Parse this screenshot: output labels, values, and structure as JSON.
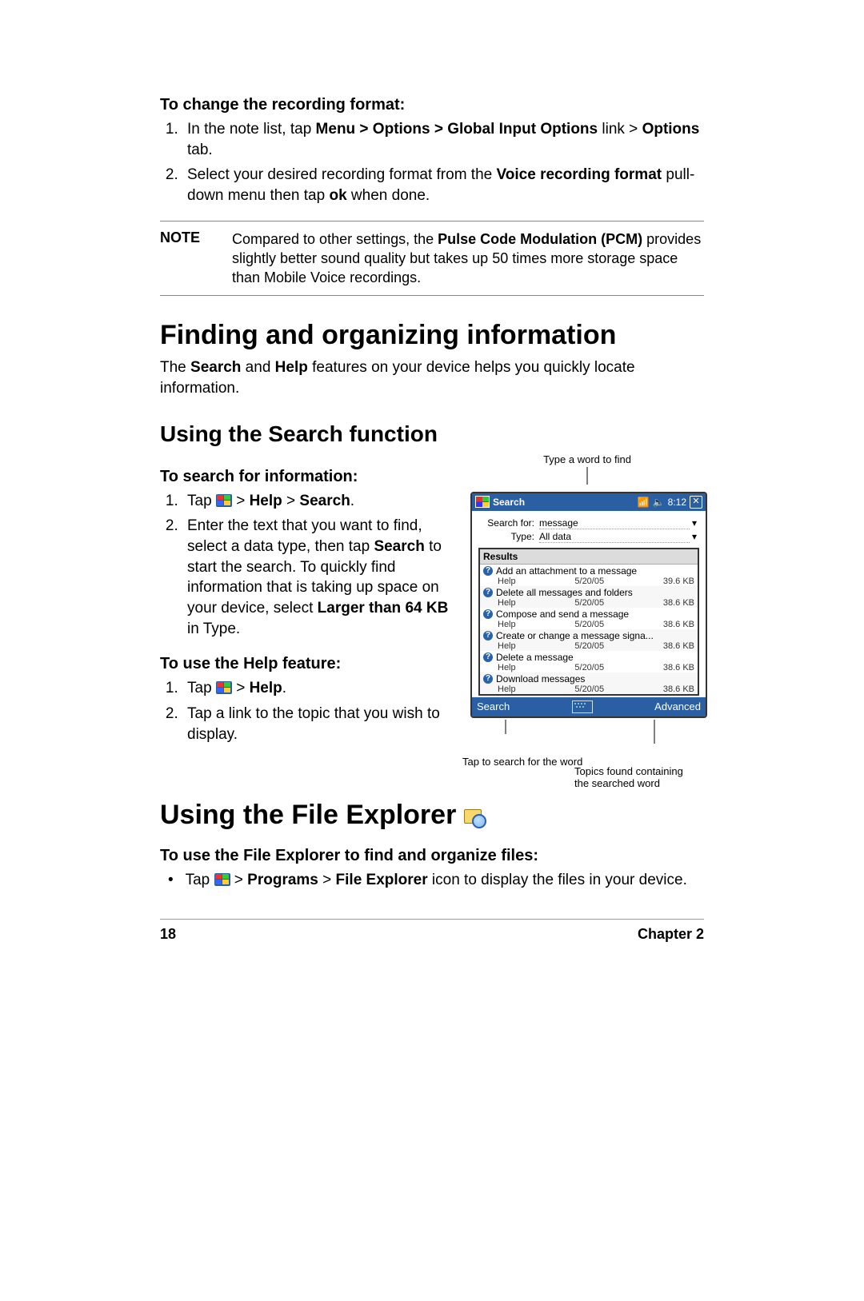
{
  "section_recording_heading": "To change the recording format:",
  "rec_steps": [
    {
      "prefix": "In the note list, tap ",
      "bold": "Menu > Options > Global Input Options",
      "mid": " link > ",
      "bold2": "Options",
      "suffix": " tab."
    },
    {
      "prefix": "Select your desired recording format from the ",
      "bold": "Voice recording format",
      "mid": " pull-down menu then tap ",
      "bold2": "ok",
      "suffix": " when done."
    }
  ],
  "note": {
    "label": "NOTE",
    "prefix": "Compared to other settings, the ",
    "bold": "Pulse Code Modulation (PCM)",
    "suffix": " provides slightly better sound quality but takes up 50 times more storage space than Mobile Voice recordings."
  },
  "h1_1": "Finding and organizing information",
  "intro": {
    "prefix": "The ",
    "b1": "Search",
    "mid": " and ",
    "b2": "Help",
    "suffix": " features on your device helps you quickly locate information."
  },
  "h2_search": "Using the Search function",
  "h3_searchinfo": "To search for information:",
  "search_steps": [
    {
      "prefix": "Tap ",
      "after": "> ",
      "b1": "Help",
      "mid": " >  ",
      "b2": "Search",
      "suffix": "."
    },
    {
      "prefix": "Enter the text that you want to find, select a data type, then tap ",
      "b1": "Search",
      "mid": " to start the search. To quickly find information that is taking up space on your device, select ",
      "b2": "Larger than 64 KB",
      "suffix": " in Type."
    }
  ],
  "h3_help": "To use the Help feature:",
  "help_steps": [
    {
      "prefix": "Tap ",
      "after": "> ",
      "b1": "Help",
      "suffix": "."
    },
    {
      "plain": "Tap a link to the topic that you wish to display."
    }
  ],
  "callout_top": "Type a word to find",
  "device": {
    "title": "Search",
    "time": "8:12",
    "field1_label": "Search for:",
    "field1_value": "message",
    "field2_label": "Type:",
    "field2_value": "All data",
    "results_label": "Results",
    "rows": [
      {
        "t": "Add an attachment to a message",
        "s": "Help",
        "d": "5/20/05",
        "k": "39.6 KB"
      },
      {
        "t": "Delete all messages and folders",
        "s": "Help",
        "d": "5/20/05",
        "k": "38.6 KB"
      },
      {
        "t": "Compose and send a message",
        "s": "Help",
        "d": "5/20/05",
        "k": "38.6 KB"
      },
      {
        "t": "Create or change a message signa...",
        "s": "Help",
        "d": "5/20/05",
        "k": "38.6 KB"
      },
      {
        "t": "Delete a message",
        "s": "Help",
        "d": "5/20/05",
        "k": "38.6 KB"
      },
      {
        "t": "Download messages",
        "s": "Help",
        "d": "5/20/05",
        "k": "38.6 KB"
      }
    ],
    "bottom_left": "Search",
    "bottom_right": "Advanced"
  },
  "callout_bottom_left": "Tap to search for the word",
  "callout_bottom_right1": "Topics found containing",
  "callout_bottom_right2": "the searched word",
  "h1_2": "Using the File Explorer",
  "h3_fileexp": "To use the File Explorer to find and organize files:",
  "fileexp_item": {
    "prefix": "Tap ",
    "after": "> ",
    "b1": "Programs",
    "mid": " > ",
    "b2": "File Explorer",
    "suffix": " icon to display the files in your device."
  },
  "footer": {
    "page": "18",
    "chapter": "Chapter 2"
  }
}
